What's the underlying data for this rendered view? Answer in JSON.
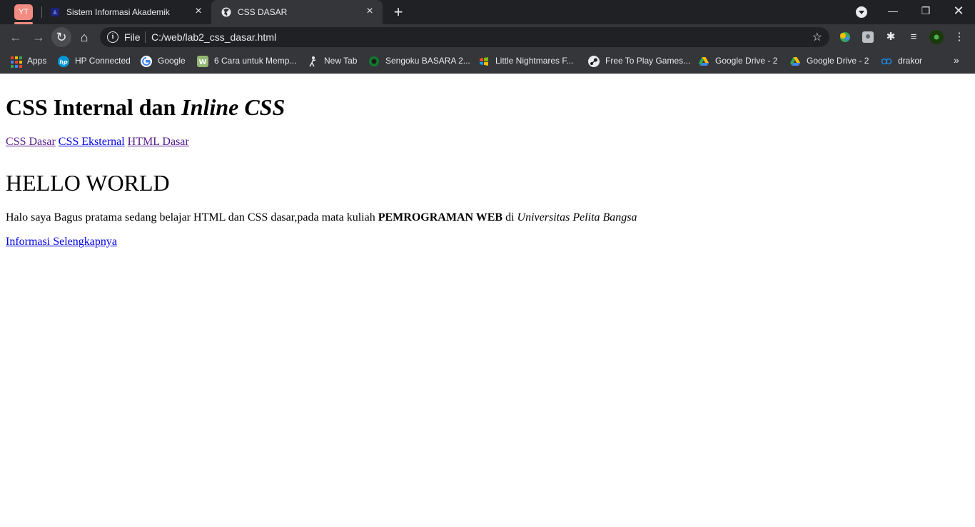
{
  "browser": {
    "pinned_tab_label": "YT",
    "tabs": [
      {
        "title": "Sistem Informasi Akademik",
        "active": false
      },
      {
        "title": "CSS DASAR",
        "active": true
      }
    ],
    "address": {
      "scheme_label": "File",
      "url": "C:/web/lab2_css_dasar.html"
    },
    "bookmarks": [
      {
        "label": "Apps"
      },
      {
        "label": "HP Connected"
      },
      {
        "label": "Google"
      },
      {
        "label": "6 Cara untuk Memp..."
      },
      {
        "label": "New Tab"
      },
      {
        "label": "Sengoku BASARA 2..."
      },
      {
        "label": "Little Nightmares F..."
      },
      {
        "label": "Free To Play Games..."
      },
      {
        "label": "Google Drive - 2"
      },
      {
        "label": "Google Drive - 2"
      },
      {
        "label": "drakor"
      }
    ],
    "colors": {
      "tabstrip": "#202124",
      "toolbar": "#35363a",
      "text": "#e8eaed",
      "yt_pill": "#f28b82"
    }
  },
  "page": {
    "heading_plain": "CSS Internal dan ",
    "heading_italic": "Inline CSS",
    "nav_links": [
      "CSS Dasar",
      "CSS Eksternal",
      "HTML Dasar"
    ],
    "hello": "HELLO WORLD",
    "paragraph": {
      "part1": "Halo saya Bagus pratama sedang belajar HTML dan CSS dasar,pada mata kuliah ",
      "bold": "PEMROGRAMAN WEB",
      "part2": " di ",
      "italic": "Universitas Pelita Bangsa"
    },
    "more_link": "Informasi Selengkapnya",
    "colors": {
      "link": "#0000ee",
      "visited": "#551a8b"
    }
  }
}
